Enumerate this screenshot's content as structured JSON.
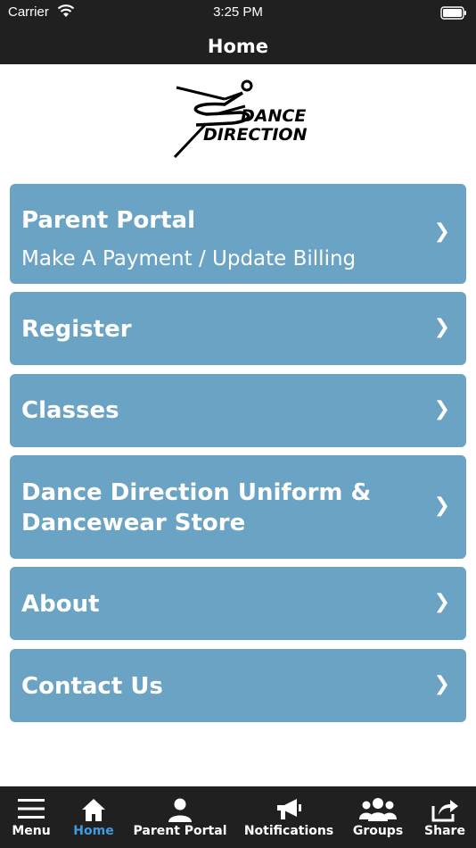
{
  "status_bar": {
    "carrier": "Carrier",
    "time": "3:25 PM"
  },
  "nav": {
    "title": "Home"
  },
  "logo": {
    "text": "DANCE DIRECTION"
  },
  "menu": {
    "parent_portal": {
      "label": "Parent Portal",
      "sublabel": "Make A Payment / Update Billing"
    },
    "register": {
      "label": "Register"
    },
    "classes": {
      "label": "Classes"
    },
    "store": {
      "label_line1": "Dance Direction Uniform &",
      "label_line2": "Dancewear Store"
    },
    "about": {
      "label": "About"
    },
    "contact": {
      "label": "Contact Us"
    },
    "chevron": "❯"
  },
  "tabs": {
    "menu": "Menu",
    "home": "Home",
    "parent_portal": "Parent Portal",
    "notifications": "Notifications",
    "groups": "Groups",
    "share": "Share"
  },
  "colors": {
    "bar_background": "#202020",
    "card_background": "#6aa3c3",
    "active_tab": "#3f9be0"
  },
  "icons": [
    "wifi-icon",
    "battery-icon",
    "menu-icon",
    "home-icon",
    "person-icon",
    "megaphone-icon",
    "groups-icon",
    "share-icon"
  ]
}
